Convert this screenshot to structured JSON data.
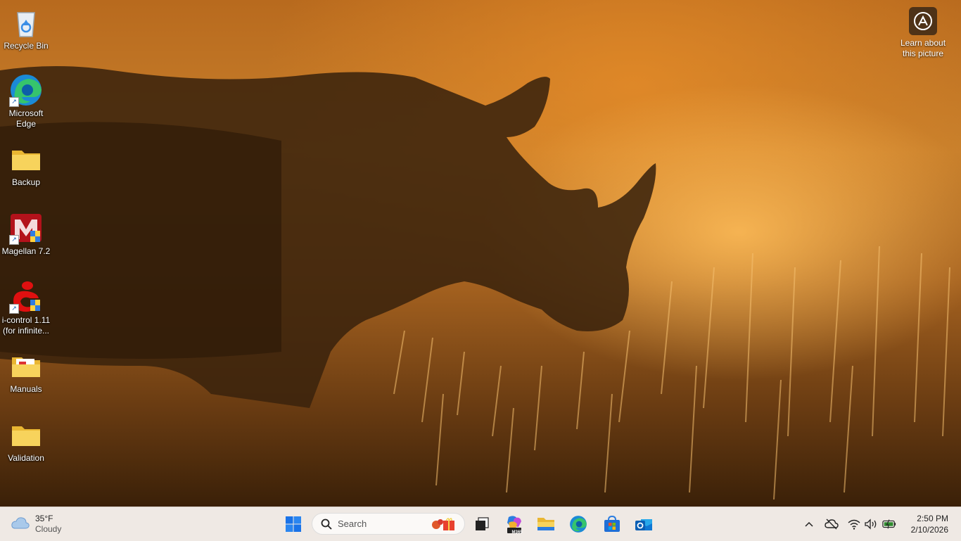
{
  "desktop": {
    "icons": [
      {
        "label": "Recycle Bin"
      },
      {
        "label": "Microsoft\nEdge"
      },
      {
        "label": "Backup"
      },
      {
        "label": "Magellan 7.2"
      },
      {
        "label": "i-control 1.11\n(for infinite..."
      },
      {
        "label": "Manuals"
      },
      {
        "label": "Validation"
      }
    ],
    "learn_about": {
      "label": "Learn about\nthis picture"
    }
  },
  "taskbar": {
    "weather": {
      "temp": "35°F",
      "condition": "Cloudy"
    },
    "search": {
      "placeholder": "Search"
    },
    "apps": [
      {
        "icon": "windows-start-icon"
      },
      {
        "icon": "task-view-icon"
      },
      {
        "icon": "m365-copilot-icon",
        "badge": "M365"
      },
      {
        "icon": "file-explorer-icon"
      },
      {
        "icon": "edge-icon"
      },
      {
        "icon": "microsoft-store-icon"
      },
      {
        "icon": "outlook-icon"
      }
    ],
    "clock": {
      "time": "2:50 PM",
      "date": "2/10/2026"
    }
  },
  "colors": {
    "taskbar_bg": "#efe9e4",
    "folder_yellow": "#f4c542",
    "windows_blue": "#1a73e8"
  }
}
